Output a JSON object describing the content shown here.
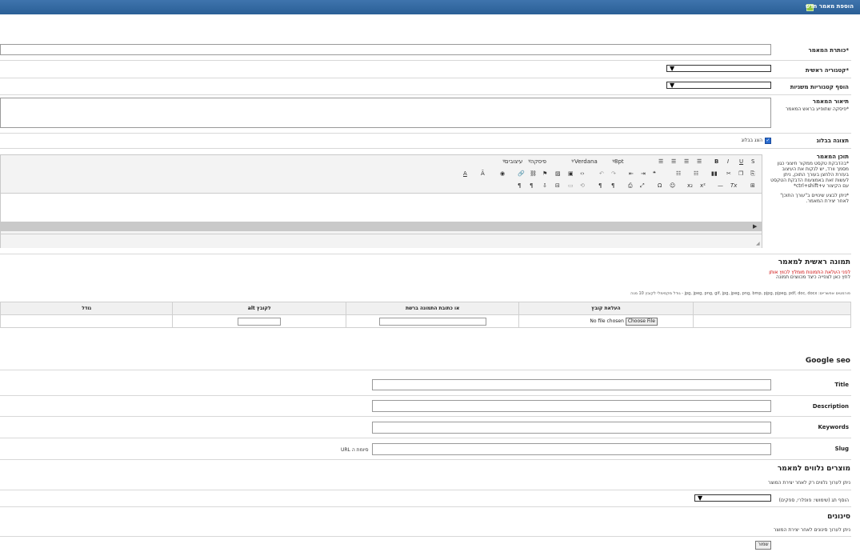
{
  "header": {
    "title": "הוספת מאמר חדש"
  },
  "form": {
    "title_label": "*כותרת המאמר",
    "category_label": "*קטגוריה ראשית",
    "secondary_label": "הוסף קטגוריות משניות",
    "description_label": "תיאור המאמר",
    "description_sub": "*פיסקה שתופיע בראש המאמר",
    "blog_label": "תצוגה בבלוג",
    "blog_checkbox_label": "הצג בבלוג",
    "blog_checked": true,
    "content_label": "תוכן המאמר",
    "content_note1": "*בהדבקת טקסט ממקור חיצוני כגון מסמך וורד, יש לנקות את העיצוב בעזרת הלחצן בעורך התוכן, ניתן לעשות זאת באמצעות הדבקת הטקסט עם הקיצור ctrl+shift+v*",
    "content_note2": "*ניתן לבצע שינויים ב\"עורך התוכן\" לאחר יצירת המאמר."
  },
  "editor": {
    "font_size": "8pt",
    "font_family": "Verdana",
    "format": "פיסקה",
    "styles": "עיצובים"
  },
  "image_section": {
    "title": "תמונה ראשית למאמר",
    "warning": "לפני העלאת התמונות מומלץ לכווץ אותן",
    "help_link": "לחץ כאן לצפייה כיצד מכווצים תמונה",
    "formats": "פורמטים אפשריים: jpg, jpeg, png, gif, jpg, jpeg, png, bmp, pjpg, pjpeg, pdf, doc, docx - גודל מקסימלי לקובץ 10 מגה",
    "columns": [
      "העלאת קובץ",
      "או כתובת התמונה ברשת",
      "alt לקובץ",
      "גודל"
    ],
    "no_file": "No file chosen",
    "choose_file": "Choose File"
  },
  "seo": {
    "title": "Google seo",
    "fields": [
      "Title",
      "Description",
      "Keywords",
      "Slug"
    ],
    "slug_suffix": "סיומת ה URL"
  },
  "products": {
    "title": "מוצרים נלווים למאמר",
    "note": "ניתן לערוך נלווים רק לאחר יצירת המוצר",
    "tag_label": "הוסף תג (שימושי: פופלרי, ספקים)"
  },
  "filters": {
    "title": "סינונים",
    "note": "ניתן לערוך סינונים לאחר יצירת המוצר"
  },
  "save_label": "שמור"
}
